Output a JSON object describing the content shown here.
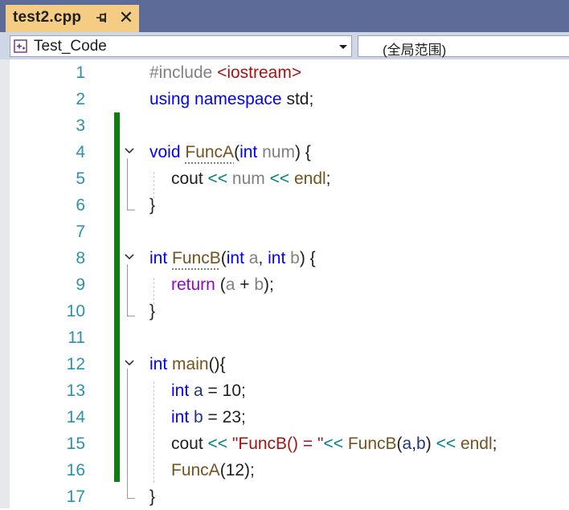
{
  "tab": {
    "title": "test2.cpp",
    "pin_label": "⍄",
    "close_label": "✕"
  },
  "navbar": {
    "project": "Test_Code",
    "scope": "(全局范围)"
  },
  "editor": {
    "line_numbers": [
      "1",
      "2",
      "3",
      "4",
      "5",
      "6",
      "7",
      "8",
      "9",
      "10",
      "11",
      "12",
      "13",
      "14",
      "15",
      "16",
      "17"
    ],
    "lines": {
      "l1": {
        "a": "#include ",
        "b": "<iostream>"
      },
      "l2": {
        "a": "using",
        "b": " ",
        "c": "namespace",
        "d": " std;"
      },
      "l4": {
        "a": "void",
        "b": " ",
        "c": "FuncA",
        "d": "(",
        "e": "int",
        "f": " ",
        "g": "num",
        "h": ") {"
      },
      "l5": {
        "a": "cout",
        "b": " << ",
        "c": "num",
        "d": " << ",
        "e": "endl",
        "f": ";"
      },
      "l6": {
        "a": "}"
      },
      "l8": {
        "a": "int",
        "b": " ",
        "c": "FuncB",
        "d": "(",
        "e": "int",
        "f": " ",
        "g": "a",
        "h": ", ",
        "i": "int",
        "j": " ",
        "k": "b",
        "l": ") {"
      },
      "l9": {
        "a": "return",
        "b": " (",
        "c": "a",
        "d": " + ",
        "e": "b",
        "f": ");"
      },
      "l10": {
        "a": "}"
      },
      "l12": {
        "a": "int",
        "b": " ",
        "c": "main",
        "d": "(){"
      },
      "l13": {
        "a": "int",
        "b": " ",
        "c": "a",
        "d": " = 10;"
      },
      "l14": {
        "a": "int",
        "b": " ",
        "c": "b",
        "d": " = 23;"
      },
      "l15": {
        "a": "cout",
        "b": " << ",
        "c": "\"FuncB() = \"",
        "d": "<< ",
        "e": "FuncB",
        "f": "(",
        "g": "a",
        "h": ",",
        "i": "b",
        "j": ") ",
        "k": "<< ",
        "l": "endl",
        "m": ";"
      },
      "l16": {
        "a": "FuncA",
        "b": "(12);"
      },
      "l17": {
        "a": "}"
      }
    }
  },
  "colors": {
    "tab_bg": "#f5cc84",
    "tabstrip_bg": "#5d6b99",
    "keyword": "#0000ff",
    "string": "#a31515",
    "line_number": "#2b91af",
    "change_bar": "#107c10"
  }
}
